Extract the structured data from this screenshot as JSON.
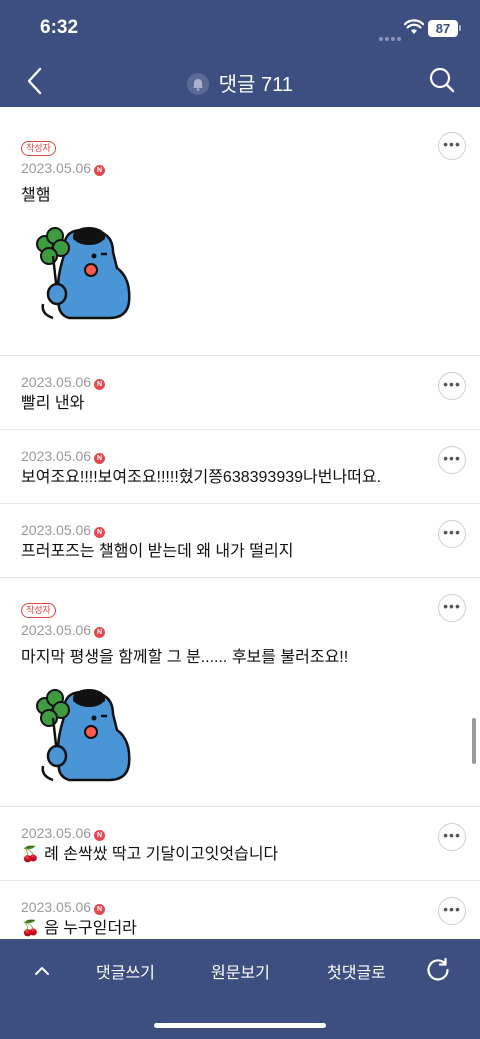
{
  "status_bar": {
    "time": "6:32",
    "battery": "87"
  },
  "nav": {
    "title": "댓글 711"
  },
  "comments": [
    {
      "author_badge": "작성자",
      "date": "2023.05.06",
      "new_label": "N",
      "text": "챌햄",
      "has_sticker": true
    },
    {
      "date": "2023.05.06",
      "new_label": "N",
      "text": "빨리 낸와"
    },
    {
      "date": "2023.05.06",
      "new_label": "N",
      "text": "보여조요!!!!보여조요!!!!!혔기쯩638393939나번나떠요."
    },
    {
      "date": "2023.05.06",
      "new_label": "N",
      "text": "프러포즈는 챌햄이 받는데 왜 내가 떨리지"
    },
    {
      "author_badge": "작성자",
      "date": "2023.05.06",
      "new_label": "N",
      "text": "마지막 평생을 함께할 그 분...... 후보를 불러조요!!",
      "has_sticker": true
    },
    {
      "date": "2023.05.06",
      "new_label": "N",
      "emoji": "🍒",
      "text": "례 손싹쌌 딱고 기달이고잇엇습니다"
    },
    {
      "date": "2023.05.06",
      "new_label": "N",
      "emoji": "🍒",
      "text": "음 누구읻더라"
    }
  ],
  "more_label": "•••",
  "bottom_bar": {
    "write": "댓글쓰기",
    "original": "원문보기",
    "first": "첫댓글로"
  },
  "icons": {
    "back": "chevron-left-icon",
    "bell": "bell-icon",
    "search": "search-icon",
    "up": "chevron-up-icon",
    "refresh": "refresh-icon",
    "more": "more-icon",
    "sticker": "clover-character-sticker",
    "cherry": "cherry-icon"
  },
  "colors": {
    "header_bg": "#3d4f80",
    "author_badge": "#e04545",
    "new_badge": "#e5484d"
  }
}
